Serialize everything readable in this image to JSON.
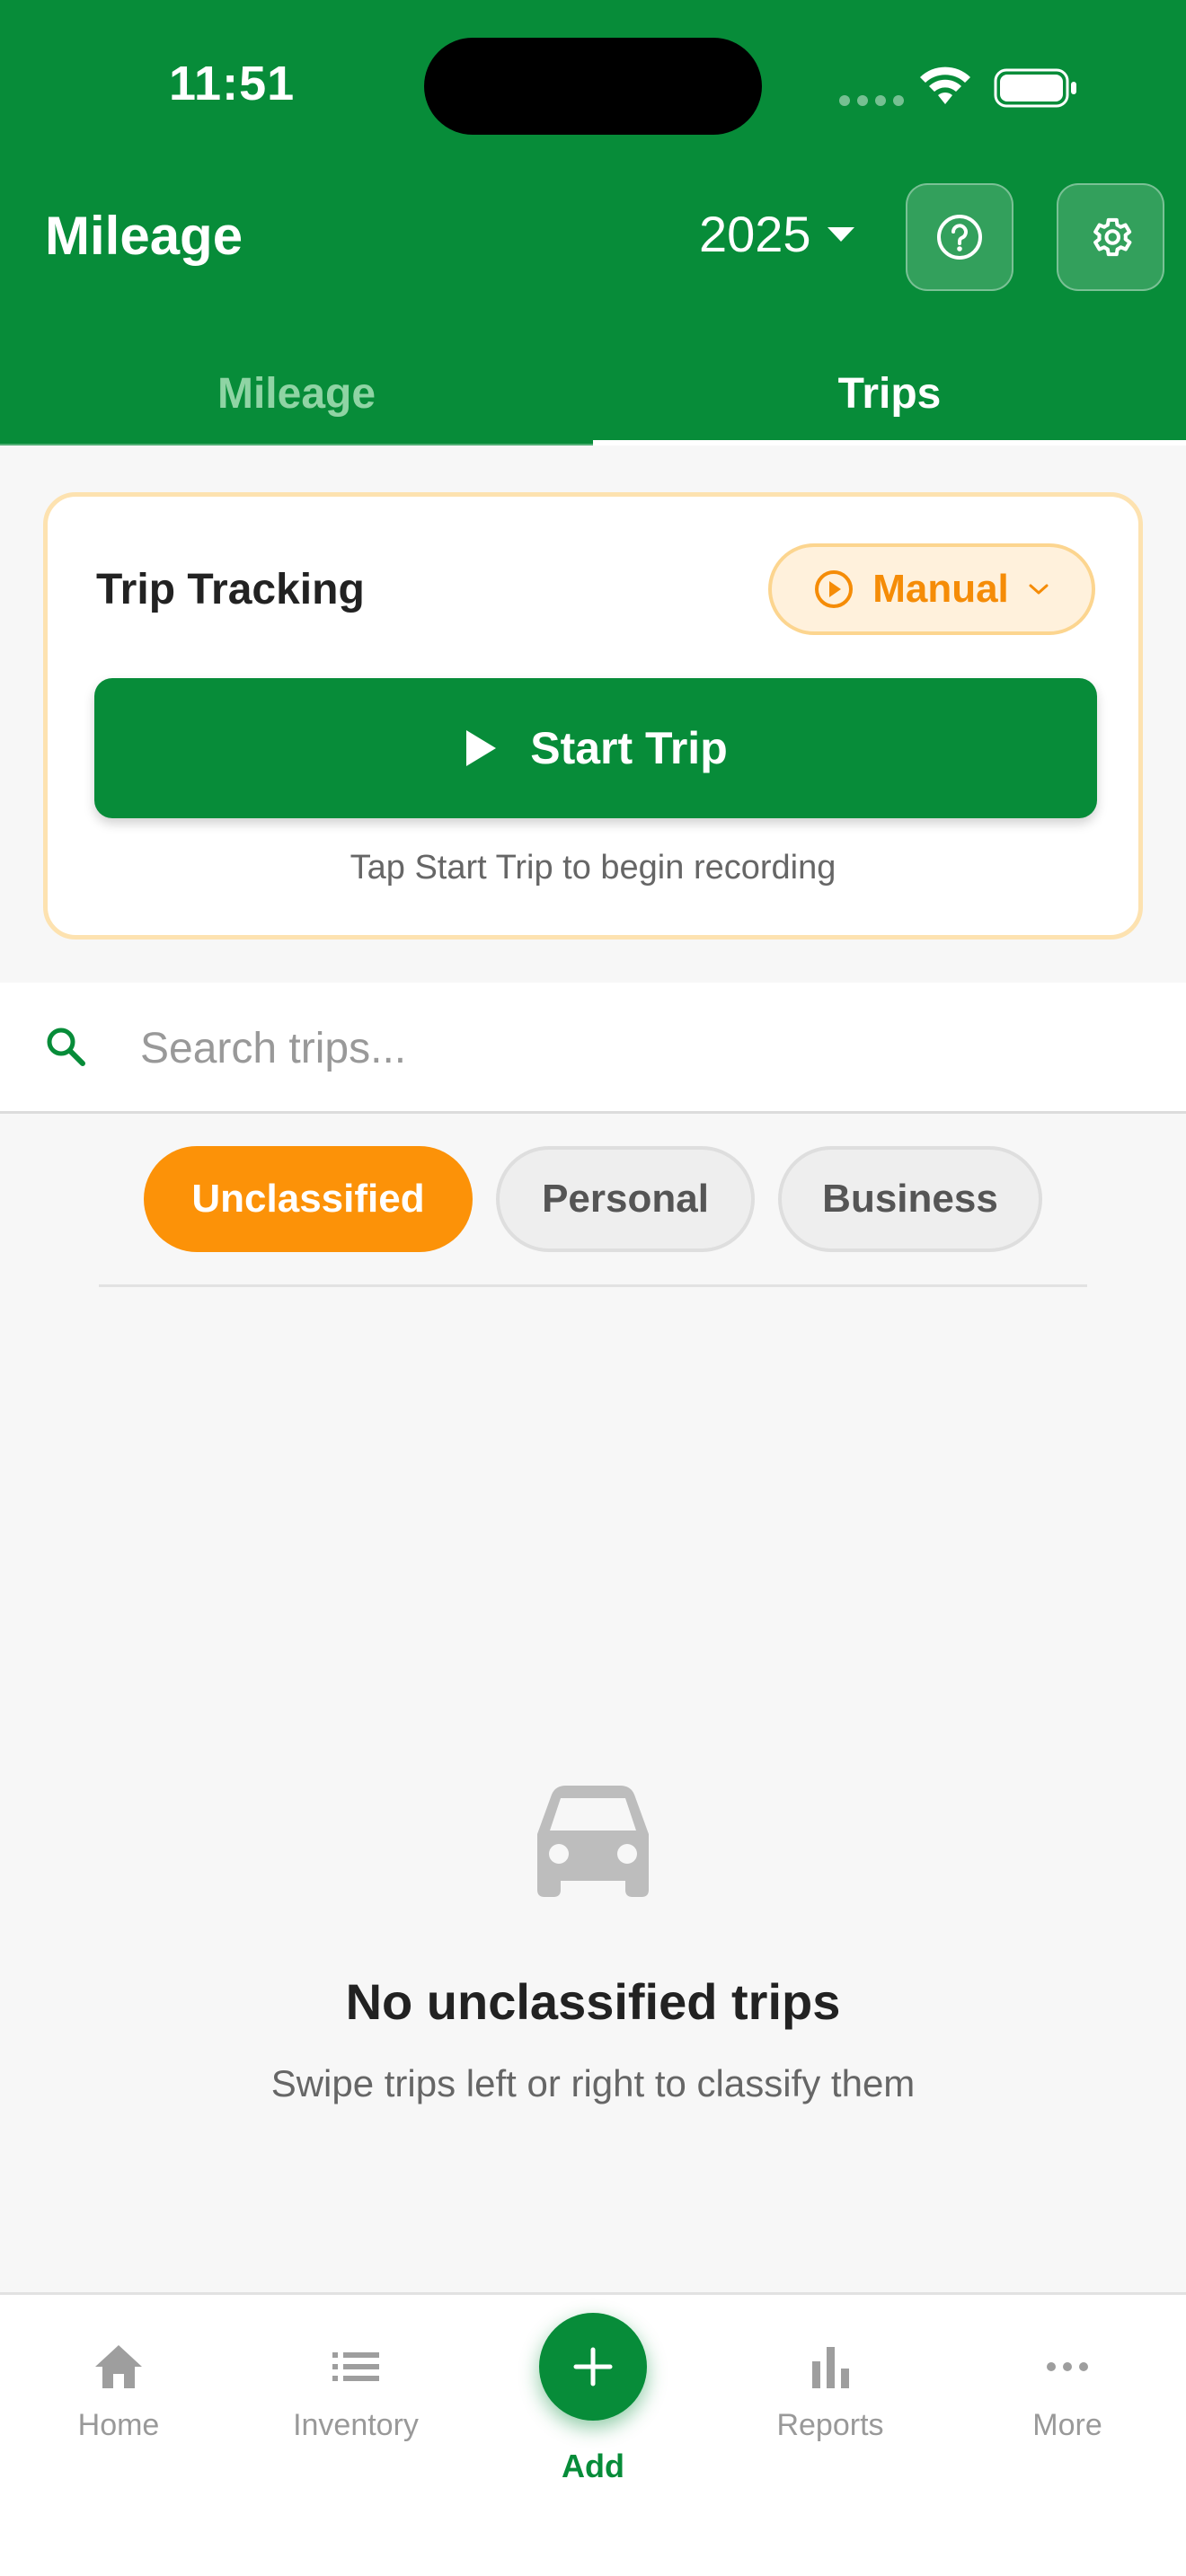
{
  "status_bar": {
    "time": "11:51"
  },
  "header": {
    "title": "Mileage",
    "year": "2025",
    "help_icon": "help-circle-icon",
    "settings_icon": "gear-icon"
  },
  "tabs": [
    {
      "label": "Mileage",
      "active": false
    },
    {
      "label": "Trips",
      "active": true
    }
  ],
  "tracking": {
    "title": "Trip Tracking",
    "mode": "Manual",
    "start_label": "Start Trip",
    "hint": "Tap Start Trip to begin recording"
  },
  "search": {
    "placeholder": "Search trips..."
  },
  "filters": [
    {
      "label": "Unclassified",
      "active": true
    },
    {
      "label": "Personal",
      "active": false
    },
    {
      "label": "Business",
      "active": false
    }
  ],
  "empty_state": {
    "icon": "car-icon",
    "title": "No unclassified trips",
    "subtitle": "Swipe trips left or right to classify them"
  },
  "bottom_nav": {
    "items": [
      {
        "label": "Home",
        "icon": "home-icon"
      },
      {
        "label": "Inventory",
        "icon": "list-icon"
      },
      {
        "label": "Add",
        "icon": "plus-icon"
      },
      {
        "label": "Reports",
        "icon": "bar-chart-icon"
      },
      {
        "label": "More",
        "icon": "more-horizontal-icon"
      }
    ]
  },
  "colors": {
    "primary": "#078c39",
    "accent": "#fc9208",
    "background": "#f7f7f7"
  }
}
